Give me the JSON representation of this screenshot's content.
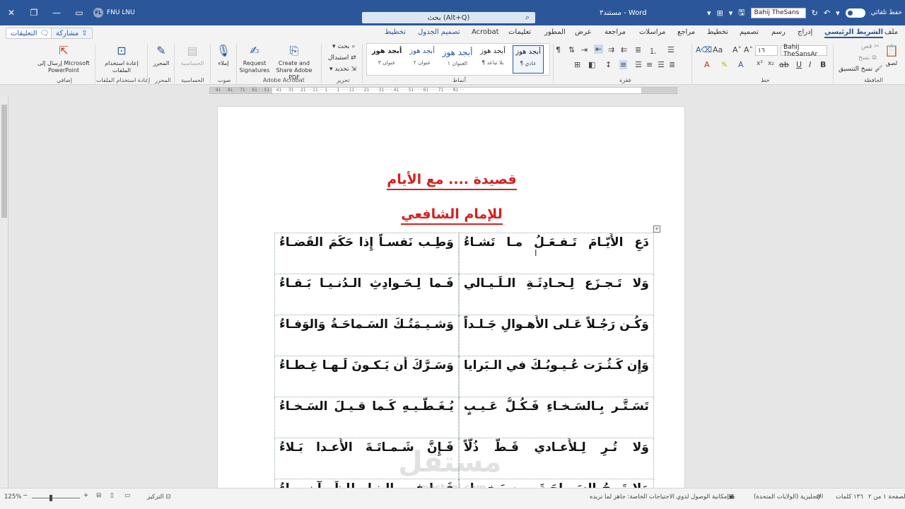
{
  "titlebar": {
    "autosave_label": "حفظ تلقائي",
    "font_mini": "Bahij TheSans",
    "doc_title": "مستند٣ - Word",
    "search_placeholder": "بحث (Alt+Q)",
    "user_name": "FNU LNU",
    "user_initials": "FL"
  },
  "tabs": {
    "file": "ملف",
    "home": "الشريط الرئيسي",
    "insert": "إدراج",
    "draw": "رسم",
    "design": "تصميم",
    "layout": "تخطيط",
    "references": "مراجع",
    "mailings": "مراسلات",
    "review": "مراجعة",
    "view": "عرض",
    "developer": "المطور",
    "help": "تعليمات",
    "acrobat": "Acrobat",
    "table_design": "تصميم الجدول",
    "table_layout": "تخطيط",
    "share": "مشاركة",
    "comments": "التعليقات"
  },
  "ribbon": {
    "clipboard": {
      "paste": "لصق",
      "cut": "قص",
      "copy": "نسخ",
      "format_painter": "نسخ التنسيق",
      "label": "الحافظة"
    },
    "font": {
      "name": "Bahij TheSansAr",
      "size": "١٦",
      "label": "خط"
    },
    "paragraph": {
      "label": "فقرة"
    },
    "styles": {
      "label": "أنماط",
      "items": [
        {
          "sample": "أبجد هوز",
          "name": "¶ عادي"
        },
        {
          "sample": "أبجد هوز",
          "name": "¶ بلا تباعد"
        },
        {
          "sample": "أبجد هوز",
          "name": "العنوان ١"
        },
        {
          "sample": "أبجد هوز",
          "name": "عنوان ٢"
        },
        {
          "sample": "أبجد هوز",
          "name": "عنوان ٣"
        }
      ]
    },
    "editing": {
      "find": "بحث",
      "replace": "استبدال",
      "select": "تحديد",
      "label": "تحرير"
    },
    "acrobat": {
      "create_share": "Create and Share Adobe PDF",
      "request_sig": "Request Signatures",
      "label": "Adobe Acrobat"
    },
    "voice": {
      "dictate": "إملاء",
      "label": "صوت"
    },
    "sensitivity": {
      "btn": "الحساسية",
      "label": "الحساسية"
    },
    "editor": {
      "btn": "المحرر",
      "label": "المحرر"
    },
    "reuse": {
      "btn": "إعادة استخدام الملفات",
      "label": "إعادة استخدام الملفات"
    },
    "addins": {
      "btn": "إرسال إلى Microsoft PowerPoint",
      "label": "إضافي"
    }
  },
  "ruler": {
    "marks": "· 91 · · 81 · · 71 · · 61 · · 51 · · 41 · · 31 · · 21 · · 11 · · 1 · · · 1 · · · 11 · · · 21 · · · 31 · · · 41 · · · 51 · · · 61 · · · 71 · · · 81 · ·"
  },
  "document": {
    "title": "قصيدة .... مع الأيام",
    "subtitle": "للإمام الشافعي",
    "verses": [
      [
        "دَعِ الأَيّـامَ تَـفـعَـلُ مـا تَشـاءُ",
        "وَطِـب نَفسـاً إِذا حَكَمَ القَضـاءُ"
      ],
      [
        "وَلا تَـجـزَع لِـحـادِثَـةِ الـلَـيـالي",
        "فَـما لِـحَـوادِثِ الـدُنـيـا بَـقـاءُ"
      ],
      [
        "وَكُـن رَجُـلاً عَـلى الأَهـوالِ جَـلـداً",
        "وَشـيـمَتُـكَ السَـماحَـةُ وَالوَفـاءُ"
      ],
      [
        "وَإِن كَـثُـرَت عُـيـوبُـكَ في الـبَرايا",
        "وَسَـرَّكَ أَن يَـكـونَ لَـهـا غِـطـاءُ"
      ],
      [
        "تَسَـتَّـر بِـالسَـخـاءِ فَـكُـلُّ عَـيـبٍ",
        "يُـغَـطّـيـهِ كَـما قـيـلَ السَـخـاءُ"
      ],
      [
        "وَلا تُـرِ لِـلأَعـادي قَـطُّ ذُلّاً",
        "فَـإِنَّ شَـمـاتَـةَ الأَعـدا بَـلاءُ"
      ],
      [
        "وَلا تَـرجُ السَـماحَـةَ مِـن بَـخـيـلٍ",
        "فَـما فـي الـنـارِ لِلظَمـآنِ مـاءُ"
      ]
    ],
    "watermark": "مستقل",
    "watermark_sub": "mostaql.com"
  },
  "statusbar": {
    "page": "الصفحة ١ من ٢",
    "words": "١٣٦ كلمات",
    "language": "الإنجليزية (الولايات المتحدة)",
    "accessibility": "إمكانية الوصول لذوي الاحتياجات الخاصة: جاهز لما تريده",
    "focus": "التركيز",
    "zoom": "125%"
  }
}
